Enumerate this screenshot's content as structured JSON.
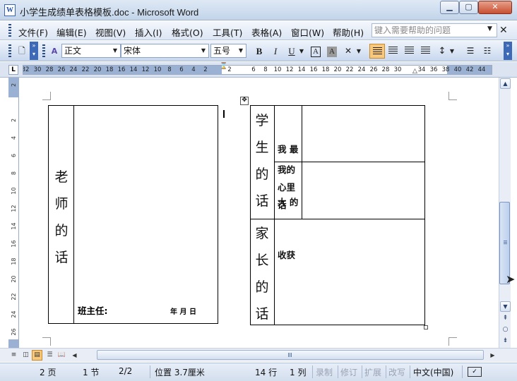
{
  "window": {
    "title": "小学生成绩单表格模板.doc - Microsoft Word",
    "app_icon": "W",
    "minimize": "▁",
    "maximize": "▢",
    "close": "✕"
  },
  "menu": {
    "items": [
      "文件(F)",
      "编辑(E)",
      "视图(V)",
      "插入(I)",
      "格式(O)",
      "工具(T)",
      "表格(A)",
      "窗口(W)",
      "帮助(H)"
    ],
    "help_placeholder": "键入需要帮助的问题"
  },
  "toolbar": {
    "style": "正文",
    "font": "宋体",
    "size": "五号",
    "bold": "B",
    "italic": "I",
    "underline": "U"
  },
  "ruler": {
    "numbers": [
      "32",
      "30",
      "28",
      "26",
      "24",
      "22",
      "20",
      "18",
      "16",
      "14",
      "12",
      "10",
      "8",
      "6",
      "4",
      "2",
      "",
      "2",
      "",
      "6",
      "8",
      "10",
      "12",
      "14",
      "16",
      "18",
      "20",
      "22",
      "24",
      "26",
      "28",
      "30",
      "",
      "34",
      "36",
      "38",
      "40",
      "42",
      "44"
    ],
    "vnumbers": [
      "2",
      "2",
      "4",
      "6",
      "8",
      "10",
      "12",
      "14",
      "16",
      "18",
      "20",
      "22",
      "24",
      "26"
    ],
    "tab_stop": "L"
  },
  "document": {
    "left_table": {
      "heading_chars": [
        "老",
        "师",
        "的",
        "话"
      ],
      "signature": "班主任:",
      "date": "年 月 日"
    },
    "right_table": {
      "student_chars": [
        "学",
        "生",
        "的",
        "话"
      ],
      "gain_lines": [
        "我 最",
        "大 的",
        "收获"
      ],
      "heart_lines": [
        "我的",
        "心里",
        "话"
      ],
      "parent_chars": [
        "家",
        "长",
        "的",
        "话"
      ]
    }
  },
  "status": {
    "page": "2 页",
    "section": "1 节",
    "page_of": "2/2",
    "position": "位置 3.7厘米",
    "line": "14 行",
    "column": "1 列",
    "rec": "录制",
    "trk": "修订",
    "ext": "扩展",
    "ovr": "改写",
    "language": "中文(中国)"
  }
}
